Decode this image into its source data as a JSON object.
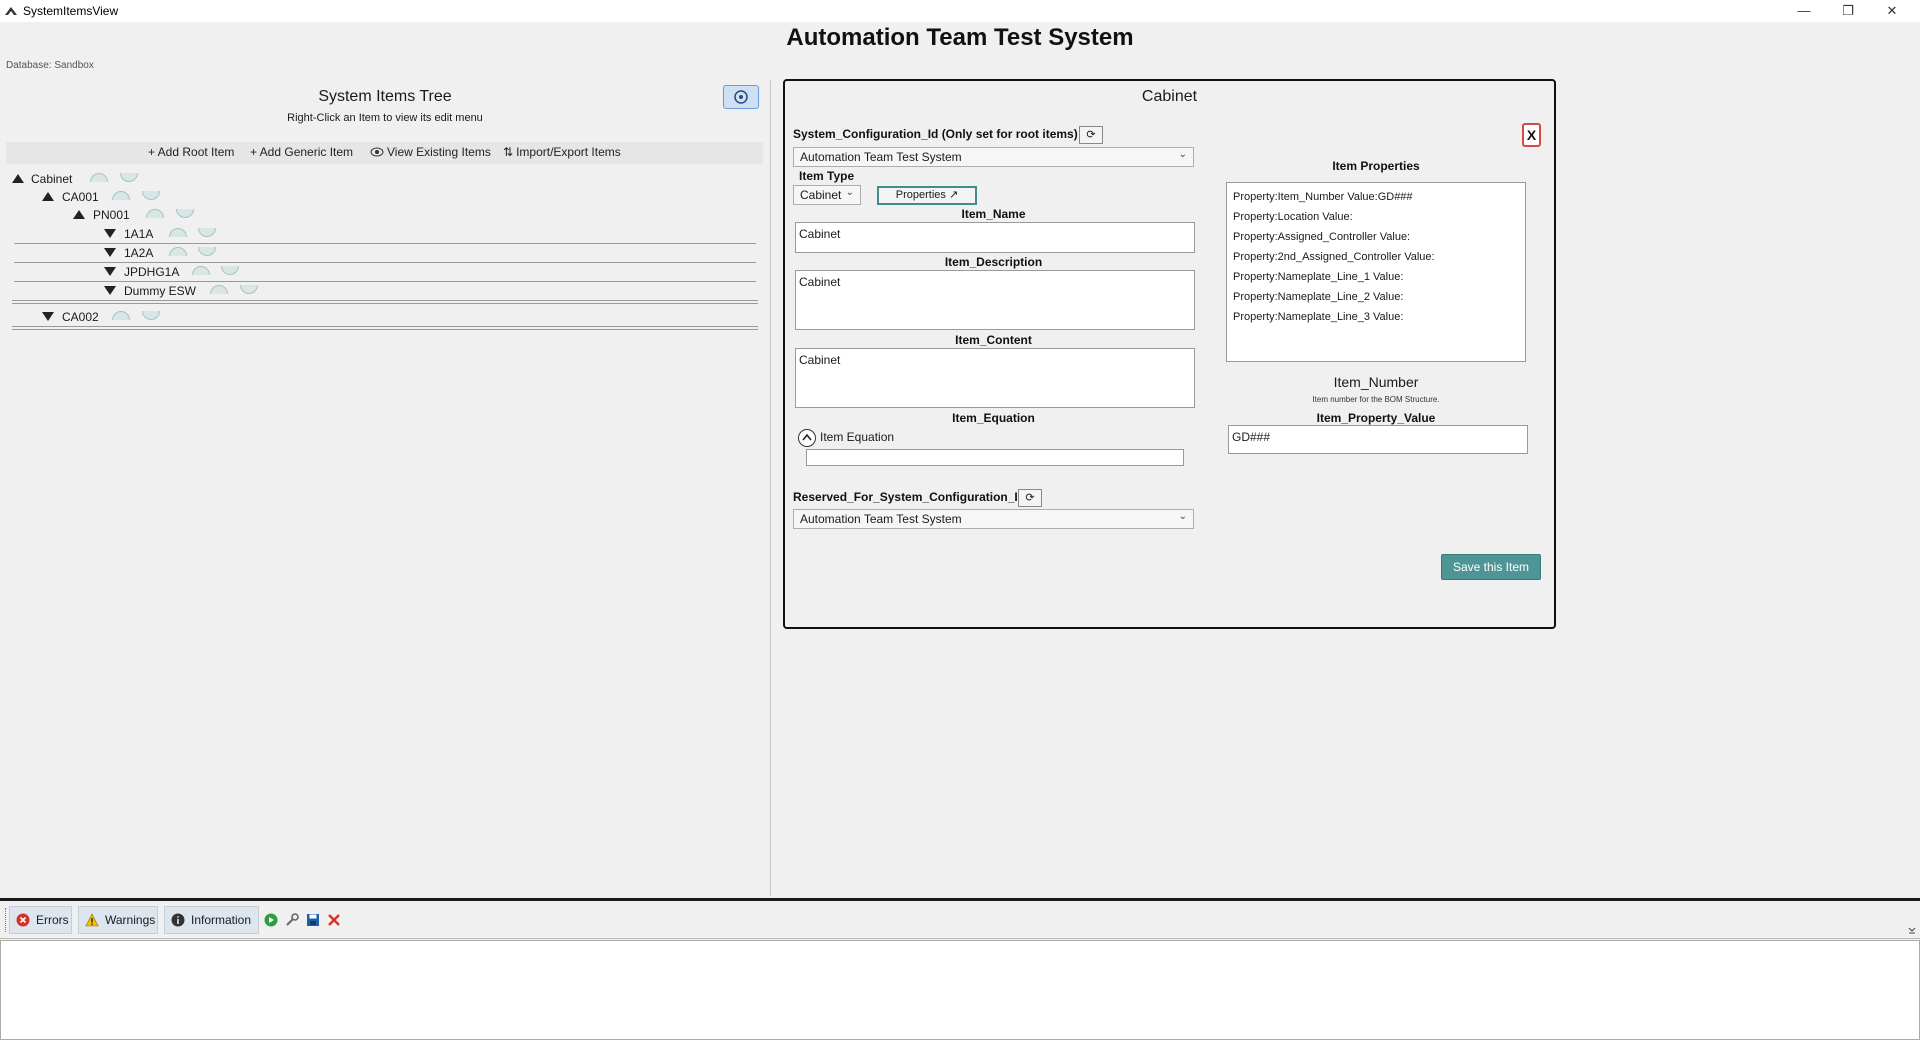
{
  "window": {
    "title": "SystemItemsView",
    "minimize_glyph": "—",
    "restore_glyph": "❐",
    "close_glyph": "✕"
  },
  "app_title": "Automation Team Test System",
  "database_label": "Database: Sandbox",
  "tree_panel": {
    "title": "System Items Tree",
    "subtitle": "Right-Click an Item to view its edit menu",
    "toolbar": {
      "add_root": "+ Add Root Item",
      "add_generic": "+ Add Generic Item",
      "view_existing": "View Existing Items",
      "import_export": "Import/Export Items",
      "view_existing_icon": "eye-icon",
      "import_export_icon": "sort-arrows-icon"
    },
    "items": [
      {
        "label": "Cabinet",
        "expanded": true
      },
      {
        "label": "CA001",
        "expanded": true
      },
      {
        "label": "PN001",
        "expanded": true
      },
      {
        "label": "1A1A",
        "expanded": false
      },
      {
        "label": "1A2A",
        "expanded": false
      },
      {
        "label": "JPDHG1A",
        "expanded": false
      },
      {
        "label": "Dummy ESW",
        "expanded": false
      },
      {
        "label": "CA002",
        "expanded": false
      }
    ]
  },
  "edit_panel": {
    "title": "Cabinet",
    "system_configuration_label": "System_Configuration_Id (Only set for root items)",
    "system_configuration_value": "Automation Team Test System",
    "item_type_label": "Item Type",
    "item_type_value": "Cabinet",
    "properties_button": "Properties ↗",
    "item_name_label": "Item_Name",
    "item_name_value": "Cabinet",
    "item_description_label": "Item_Description",
    "item_description_value": "Cabinet",
    "item_content_label": "Item_Content",
    "item_content_value": "Cabinet",
    "item_equation_label": "Item_Equation",
    "item_equation_toggle": "Item Equation",
    "item_equation_value": "",
    "reserved_label": "Reserved_For_System_Configuration_Id",
    "reserved_value": "Automation Team Test System",
    "close_label": "X",
    "item_properties_label": "Item Properties",
    "properties": [
      "Property:Item_Number Value:GD###",
      "Property:Location Value:",
      "Property:Assigned_Controller Value:",
      "Property:2nd_Assigned_Controller Value:",
      "Property:Nameplate_Line_1 Value:",
      "Property:Nameplate_Line_2 Value:",
      "Property:Nameplate_Line_3 Value:"
    ],
    "selected_property_name": "Item_Number",
    "selected_property_hint": "Item number for the BOM Structure.",
    "item_property_value_label": "Item_Property_Value",
    "item_property_value": "GD###",
    "save_button": "Save this Item"
  },
  "bottom_panel": {
    "tabs": [
      {
        "label": "Errors",
        "icon": "error-icon"
      },
      {
        "label": "Warnings",
        "icon": "warning-icon"
      },
      {
        "label": "Information",
        "icon": "info-icon"
      }
    ],
    "actions": [
      "run-icon",
      "wrench-icon",
      "save-icon",
      "clear-icon"
    ]
  },
  "colors": {
    "accent_teal": "#4f9595",
    "close_border": "#d24a4a",
    "error_red": "#d93025",
    "warning_yellow": "#f2c200",
    "run_green": "#2e9e3e",
    "save_blue": "#1f5fa8"
  }
}
